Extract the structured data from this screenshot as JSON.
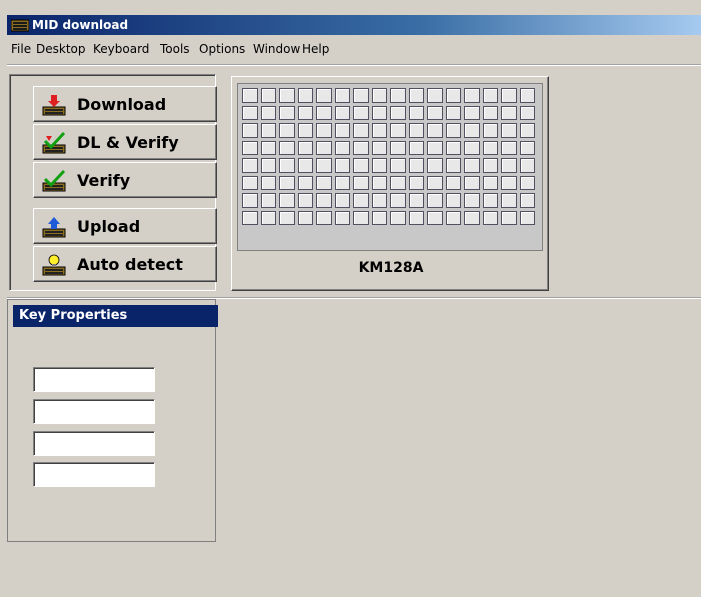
{
  "window": {
    "title": "MID download"
  },
  "menu": [
    "File",
    "Desktop",
    "Keyboard",
    "Tools",
    "Options",
    "Window",
    "Help"
  ],
  "toolbar": {
    "download": "Download",
    "dl_verify": "DL & Verify",
    "verify": "Verify",
    "upload": "Upload",
    "auto_detect": "Auto detect"
  },
  "keyboard": {
    "model": "KM128A",
    "rows": 8,
    "columns": 16
  },
  "key_properties": {
    "title": "Key Properties",
    "fields": [
      "",
      "",
      "",
      ""
    ]
  },
  "colors": {
    "title_bar": "#0a246a",
    "panel_header": "#0a246a",
    "window_bg": "#d4d0c8"
  }
}
